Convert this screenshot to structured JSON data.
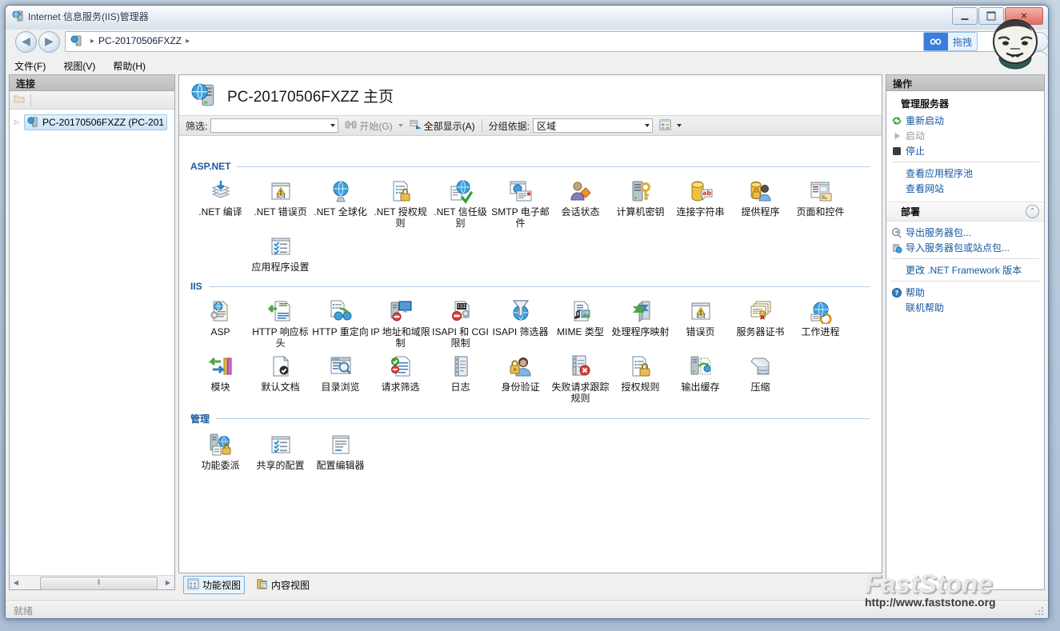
{
  "window": {
    "title": "Internet 信息服务(IIS)管理器",
    "icon": "iis-server-icon",
    "minimize_label": "最小化",
    "maximize_label": "最大化",
    "close_label": "关闭"
  },
  "navbar": {
    "back_label": "◀",
    "forward_label": "▶",
    "breadcrumb_root_icon": "iis-server-icon",
    "breadcrumb": [
      "PC-20170506FXZZ"
    ],
    "breadcrumb_sep": "▸",
    "refresh_label": "↻",
    "netdisk_badge_icon": "baidu-netdisk-icon",
    "netdisk_badge_text": "拖拽"
  },
  "menubar": {
    "items": [
      {
        "label": "文件(F)"
      },
      {
        "label": "视图(V)"
      },
      {
        "label": "帮助(H)"
      }
    ]
  },
  "connections": {
    "header": "连接",
    "tool_icon": "connect-to-server-icon",
    "tree": [
      {
        "label": "PC-20170506FXZZ (PC-201",
        "icon": "server-node-icon",
        "expander": "▷"
      }
    ],
    "hscroll_thumb": "⦀",
    "hscroll_left": "◀",
    "hscroll_right": "▶"
  },
  "page": {
    "title": "PC-20170506FXZZ 主页",
    "title_icon": "iis-server-icon"
  },
  "filterbar": {
    "filter_label": "筛选:",
    "filter_value": "",
    "go_label": "开始(G)",
    "go_icon": "binoculars-icon",
    "show_all_label": "全部显示(A)",
    "show_all_icon": "show-all-icon",
    "group_by_label": "分组依据:",
    "group_by_value": "区域",
    "view_icon": "view-mode-icon"
  },
  "groups": [
    {
      "name": "ASP.NET",
      "items": [
        {
          "label": ".NET 编译",
          "icon": "net-compilation-icon"
        },
        {
          "label": ".NET 错误页",
          "icon": "net-error-pages-icon"
        },
        {
          "label": ".NET 全球化",
          "icon": "net-globalization-icon"
        },
        {
          "label": ".NET 授权规则",
          "icon": "net-authorization-rules-icon"
        },
        {
          "label": ".NET 信任级别",
          "icon": "net-trust-levels-icon"
        },
        {
          "label": "SMTP 电子邮件",
          "icon": "smtp-email-icon"
        },
        {
          "label": "会话状态",
          "icon": "session-state-icon"
        },
        {
          "label": "计算机密钥",
          "icon": "machine-key-icon"
        },
        {
          "label": "连接字符串",
          "icon": "connection-strings-icon"
        },
        {
          "label": "提供程序",
          "icon": "providers-icon"
        },
        {
          "label": "页面和控件",
          "icon": "pages-and-controls-icon"
        },
        {
          "label": "应用程序设置",
          "icon": "application-settings-icon"
        }
      ]
    },
    {
      "name": "IIS",
      "items": [
        {
          "label": "ASP",
          "icon": "asp-icon"
        },
        {
          "label": "HTTP 响应标头",
          "icon": "http-response-headers-icon"
        },
        {
          "label": "HTTP 重定向",
          "icon": "http-redirect-icon"
        },
        {
          "label": "IP 地址和域限制",
          "icon": "ip-address-domain-restrictions-icon"
        },
        {
          "label": "ISAPI 和 CGI 限制",
          "icon": "isapi-cgi-restrictions-icon"
        },
        {
          "label": "ISAPI 筛选器",
          "icon": "isapi-filters-icon"
        },
        {
          "label": "MIME 类型",
          "icon": "mime-types-icon"
        },
        {
          "label": "处理程序映射",
          "icon": "handler-mappings-icon"
        },
        {
          "label": "错误页",
          "icon": "error-pages-icon"
        },
        {
          "label": "服务器证书",
          "icon": "server-certificates-icon"
        },
        {
          "label": "工作进程",
          "icon": "worker-processes-icon"
        },
        {
          "label": "模块",
          "icon": "modules-icon"
        },
        {
          "label": "默认文档",
          "icon": "default-document-icon"
        },
        {
          "label": "目录浏览",
          "icon": "directory-browsing-icon"
        },
        {
          "label": "请求筛选",
          "icon": "request-filtering-icon"
        },
        {
          "label": "日志",
          "icon": "logging-icon"
        },
        {
          "label": "身份验证",
          "icon": "authentication-icon"
        },
        {
          "label": "失败请求跟踪规则",
          "icon": "failed-request-tracing-rules-icon"
        },
        {
          "label": "授权规则",
          "icon": "authorization-rules-icon"
        },
        {
          "label": "输出缓存",
          "icon": "output-caching-icon"
        },
        {
          "label": "压缩",
          "icon": "compression-icon"
        }
      ]
    },
    {
      "name": "管理",
      "items": [
        {
          "label": "功能委派",
          "icon": "feature-delegation-icon"
        },
        {
          "label": "共享的配置",
          "icon": "shared-configuration-icon"
        },
        {
          "label": "配置编辑器",
          "icon": "configuration-editor-icon"
        }
      ]
    }
  ],
  "viewtabs": [
    {
      "label": "功能视图",
      "icon": "features-view-icon",
      "active": true
    },
    {
      "label": "内容视图",
      "icon": "content-view-icon",
      "active": false
    }
  ],
  "actions": {
    "header": "操作",
    "manage_server_title": "管理服务器",
    "items": [
      {
        "label": "重新启动",
        "icon": "restart-icon",
        "disabled": false
      },
      {
        "label": "启动",
        "icon": "start-icon",
        "disabled": true
      },
      {
        "label": "停止",
        "icon": "stop-icon",
        "disabled": false
      }
    ],
    "links": [
      {
        "label": "查看应用程序池"
      },
      {
        "label": "查看网站"
      }
    ],
    "deploy_group": "部署",
    "deploy_collapse": "⌃",
    "deploy_items": [
      {
        "label": "导出服务器包...",
        "icon": "export-package-icon"
      },
      {
        "label": "导入服务器包或站点包...",
        "icon": "import-package-icon"
      }
    ],
    "deploy_links": [
      {
        "label": "更改 .NET Framework 版本"
      }
    ],
    "help_items": [
      {
        "label": "帮助",
        "icon": "help-icon"
      }
    ],
    "help_links": [
      {
        "label": "联机帮助"
      }
    ]
  },
  "statusbar": {
    "text": "就绪"
  },
  "watermark": {
    "title": "FastStone",
    "url": "http://www.faststone.org"
  },
  "colors": {
    "group_header": "#1a5a9e",
    "action_link": "#15569e",
    "accent_blue": "#3b7ddd"
  }
}
